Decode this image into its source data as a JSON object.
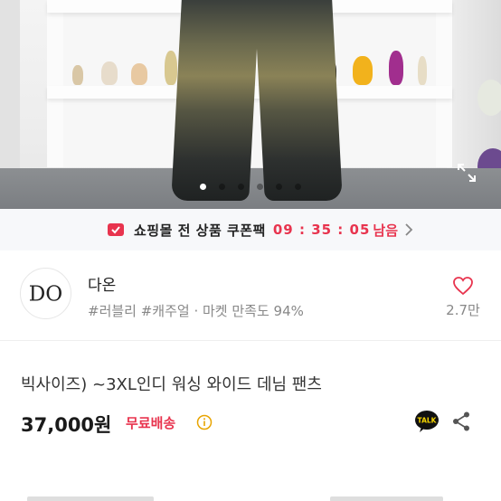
{
  "photo": {
    "slide_count": 6,
    "active_index": 0
  },
  "coupon": {
    "label": "쇼핑몰 전 상품 쿠폰팩",
    "timer": "09 : 35 : 05",
    "remaining": "남음",
    "accent_color": "#e8344e"
  },
  "seller": {
    "name": "다온",
    "tags": "#러블리 #캐주얼 · 마켓 만족도 94%",
    "avatar_text": "DO",
    "likes": "2.7만"
  },
  "product": {
    "title": "빅사이즈) ~3XL인디 워싱 와이드 데님 팬츠",
    "price": "37,000원",
    "shipping": "무료배송"
  },
  "icons": {
    "expand": "expand-icon",
    "coupon": "coupon-icon",
    "heart": "heart-icon",
    "info": "info-icon",
    "talk": "talk-icon",
    "share": "share-icon",
    "talk_label": "TALK"
  }
}
